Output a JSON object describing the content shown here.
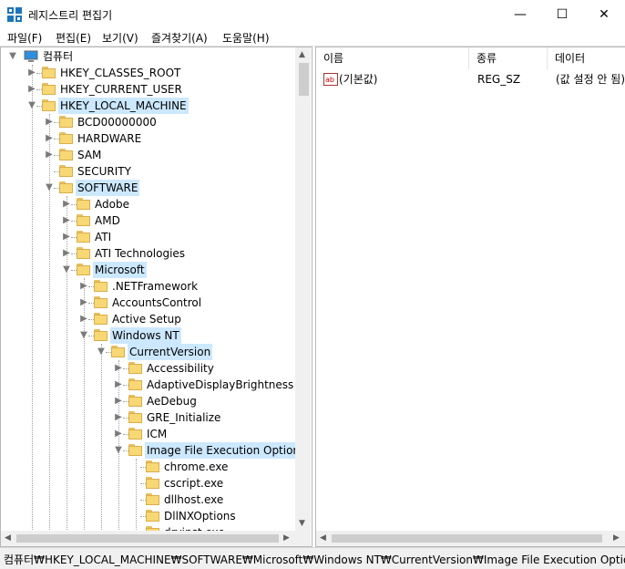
{
  "window": {
    "title": "레지스트리 편집기",
    "controls": {
      "minimize": "—",
      "maximize": "☐",
      "close": "✕"
    }
  },
  "menu": [
    "파일(F)",
    "편집(E)",
    "보기(V)",
    "즐겨찾기(A)",
    "도움말(H)"
  ],
  "tree": {
    "root": "컴퓨터",
    "items": [
      {
        "label": "HKEY_CLASSES_ROOT",
        "level": 1,
        "expander": "collapsed",
        "selected": false
      },
      {
        "label": "HKEY_CURRENT_USER",
        "level": 1,
        "expander": "collapsed",
        "selected": false
      },
      {
        "label": "HKEY_LOCAL_MACHINE",
        "level": 1,
        "expander": "expanded",
        "selected": true
      },
      {
        "label": "BCD00000000",
        "level": 2,
        "expander": "collapsed",
        "selected": false
      },
      {
        "label": "HARDWARE",
        "level": 2,
        "expander": "collapsed",
        "selected": false
      },
      {
        "label": "SAM",
        "level": 2,
        "expander": "collapsed",
        "selected": false
      },
      {
        "label": "SECURITY",
        "level": 2,
        "expander": "none",
        "selected": false
      },
      {
        "label": "SOFTWARE",
        "level": 2,
        "expander": "expanded",
        "selected": true
      },
      {
        "label": "Adobe",
        "level": 3,
        "expander": "collapsed",
        "selected": false
      },
      {
        "label": "AMD",
        "level": 3,
        "expander": "collapsed",
        "selected": false
      },
      {
        "label": "ATI",
        "level": 3,
        "expander": "collapsed",
        "selected": false
      },
      {
        "label": "ATI Technologies",
        "level": 3,
        "expander": "collapsed",
        "selected": false
      },
      {
        "label": "Microsoft",
        "level": 3,
        "expander": "expanded",
        "selected": true
      },
      {
        "label": ".NETFramework",
        "level": 4,
        "expander": "collapsed",
        "selected": false
      },
      {
        "label": "AccountsControl",
        "level": 4,
        "expander": "collapsed",
        "selected": false
      },
      {
        "label": "Active Setup",
        "level": 4,
        "expander": "collapsed",
        "selected": false
      },
      {
        "label": "Windows NT",
        "level": 4,
        "expander": "expanded",
        "selected": true
      },
      {
        "label": "CurrentVersion",
        "level": 5,
        "expander": "expanded",
        "selected": true
      },
      {
        "label": "Accessibility",
        "level": 6,
        "expander": "collapsed",
        "selected": false
      },
      {
        "label": "AdaptiveDisplayBrightness",
        "level": 6,
        "expander": "collapsed",
        "selected": false
      },
      {
        "label": "AeDebug",
        "level": 6,
        "expander": "collapsed",
        "selected": false
      },
      {
        "label": "GRE_Initialize",
        "level": 6,
        "expander": "collapsed",
        "selected": false
      },
      {
        "label": "ICM",
        "level": 6,
        "expander": "collapsed",
        "selected": false
      },
      {
        "label": "Image File Execution Options",
        "level": 6,
        "expander": "expanded",
        "selected": true
      },
      {
        "label": "chrome.exe",
        "level": 7,
        "expander": "none",
        "selected": false
      },
      {
        "label": "cscript.exe",
        "level": 7,
        "expander": "none",
        "selected": false
      },
      {
        "label": "dllhost.exe",
        "level": 7,
        "expander": "none",
        "selected": false
      },
      {
        "label": "DllNXOptions",
        "level": 7,
        "expander": "none",
        "selected": false
      },
      {
        "label": "drvinst.exe",
        "level": 7,
        "expander": "none",
        "selected": false
      }
    ]
  },
  "list": {
    "columns": [
      "이름",
      "종류",
      "데이터"
    ],
    "rows": [
      {
        "icon": "string-value-icon",
        "name": "(기본값)",
        "type": "REG_SZ",
        "data": "(값 설정 안 됨)"
      }
    ]
  },
  "status": "컴퓨터₩HKEY_LOCAL_MACHINE₩SOFTWARE₩Microsoft₩Windows NT₩CurrentVersion₩Image File Execution Options",
  "colors": {
    "selection": "#cce8ff",
    "folder": "#f8d775",
    "app_icon": "#1c75bc"
  }
}
